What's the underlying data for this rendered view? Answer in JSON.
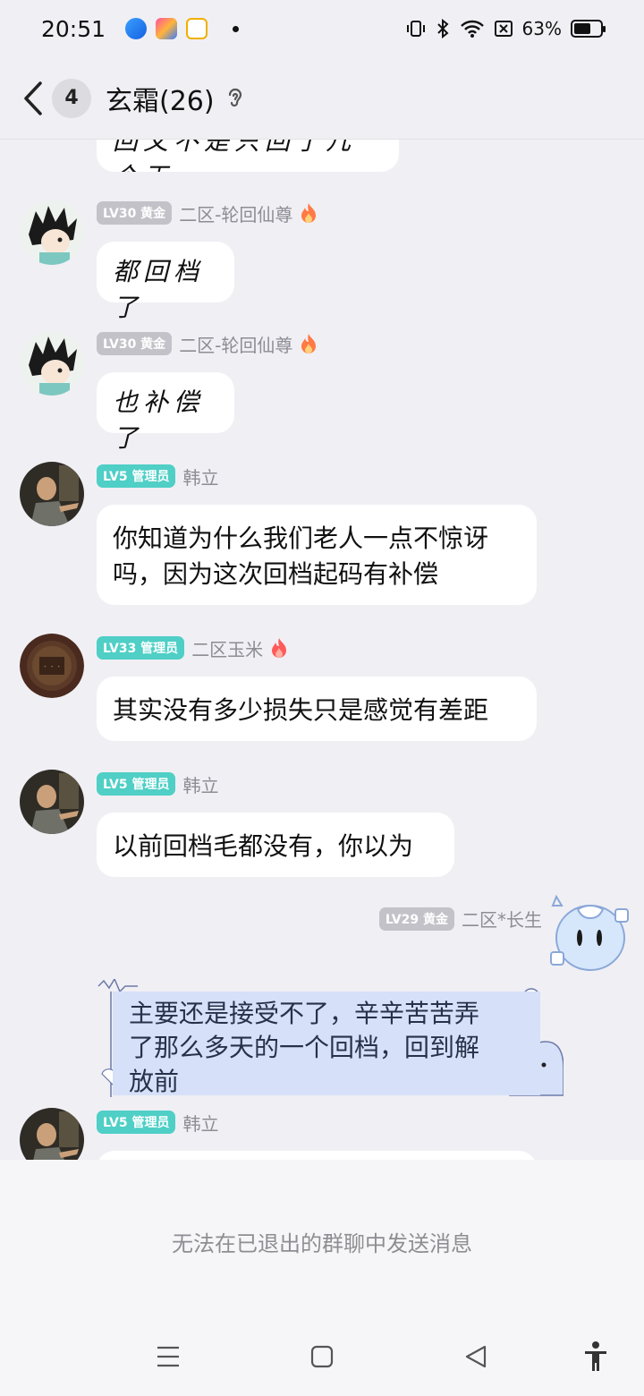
{
  "status_bar": {
    "time": "20:51",
    "battery": "63%",
    "battery_level": 0.63
  },
  "header": {
    "unread_count": "4",
    "title": "玄霜(26)"
  },
  "messages": [
    {
      "partial_text": "回文不是只回了几个天"
    },
    {
      "level": "LV30 黄金",
      "sender": "二区-轮回仙尊",
      "text": "都回档了"
    },
    {
      "level": "LV30 黄金",
      "sender": "二区-轮回仙尊",
      "text": "也补偿了"
    },
    {
      "level": "LV5 管理员",
      "sender": "韩立",
      "text_line1": "你知道为什么我们老人一点不惊讶",
      "text_line2": "吗，因为这次回档起码有补偿"
    },
    {
      "level": "LV33 管理员",
      "sender": "二区玉米",
      "text": "其实没有多少损失只是感觉有差距"
    },
    {
      "level": "LV5 管理员",
      "sender": "韩立",
      "text": "以前回档毛都没有，你以为"
    },
    {
      "level": "LV29 黄金",
      "sender": "二区*长生",
      "text_line1": "主要还是接受不了，辛辛苦苦弄",
      "text_line2": "了那么多天的一个回档，回到解",
      "text_line3": "放前"
    },
    {
      "level": "LV5 管理员",
      "sender": "韩立"
    }
  ],
  "footer": {
    "disabled_note": "无法在已退出的群聊中发送消息"
  },
  "colors": {
    "background": "#f0eff4",
    "admin_badge": "#4fcfc6",
    "gold_badge": "#c3c2c8"
  }
}
